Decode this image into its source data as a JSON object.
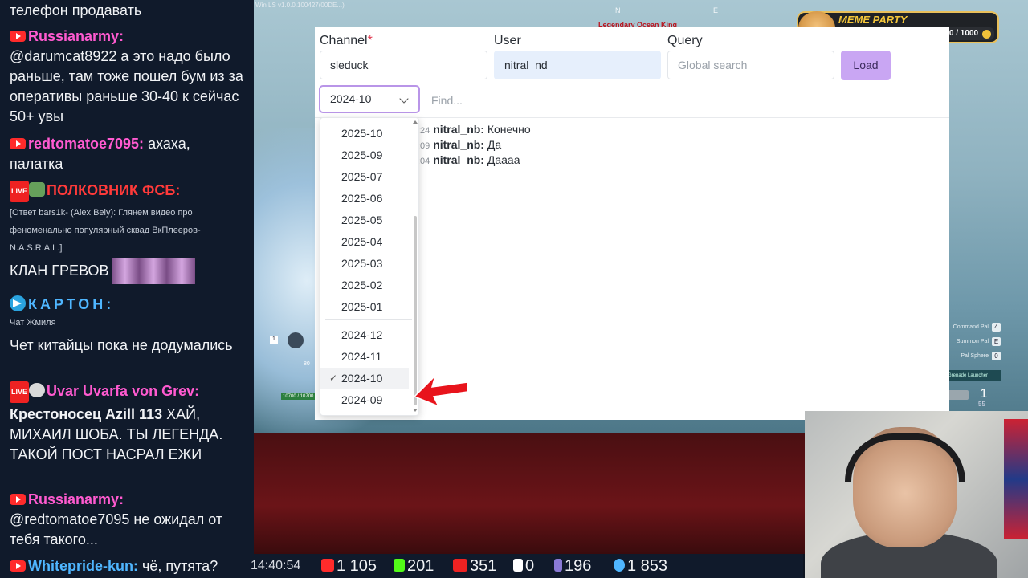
{
  "game": {
    "window_label": "Win LS v1.0.0.100427(00DE...)",
    "compass_n": "N",
    "compass_e": "E",
    "boss_name": "Legendary Ocean King",
    "hud_items": [
      {
        "label": "Command Pal",
        "key": "4"
      },
      {
        "label": "Summon Pal",
        "key": "E"
      },
      {
        "label": "Pal Sphere",
        "key": "0"
      }
    ],
    "launcher": "Grenade Launcher",
    "ammo": "1",
    "ammo_reserve": "55",
    "hp": "10700 / 10700",
    "level": "80"
  },
  "meme_party": {
    "title": "MEME PARTY",
    "count": "200 / 1000"
  },
  "chat": {
    "top_line": "телефон продавать",
    "messages": [
      {
        "author": "Russianarmy:",
        "text": "@darumcat8922 а это надо было раньше, там тоже пошел бум из за оперативы раньше 30-40 к сейчас 50+ увы"
      },
      {
        "author": "redtomatoe7095:",
        "text": "ахаха, палатка"
      },
      {
        "author": "ПОЛКОВНИК ФСБ:",
        "text": "[Ответ bars1k- (Alex Bely): Глянем видео про феноменально популярный сквад ВкПлееров-N.A.S.R.A.L.]"
      },
      {
        "author": "",
        "text": "КЛАН ГРЕВОВ"
      },
      {
        "author": "КАРТОН:",
        "text": "Чат Жмиля"
      },
      {
        "author": "",
        "text": "Чет китайцы пока не додумались"
      },
      {
        "author": "Uvar Uvarfa von Grev:",
        "text_bold": "Крестоносец Azill 113",
        "text": "ХАЙ, МИХАИЛ ШОБА. ТЫ ЛЕГЕНДА. ТАКОЙ ПОСТ НАСРАЛ ЕЖИ"
      },
      {
        "author": "Russianarmy:",
        "text": "@redtomatoe7095 не ожидал от тебя такого..."
      }
    ],
    "bottom_author": "Whitepride-kun:",
    "bottom_text": "чё, путята?"
  },
  "stats": {
    "time": "14:40:54",
    "youtube": "1 105",
    "kick": "201",
    "vk": "351",
    "rutube": "0",
    "hourglass": "196",
    "users": "1 853"
  },
  "app": {
    "channel_label": "Channel",
    "channel_required": "*",
    "channel_value": "sleduck",
    "user_label": "User",
    "user_value": "nitral_nd",
    "query_label": "Query",
    "query_placeholder": "Global search",
    "load_label": "Load",
    "month_selected": "2024-10",
    "find_placeholder": "Find...",
    "logs": [
      {
        "ts": ":24",
        "user": "nitral_nb:",
        "text": "Конечно"
      },
      {
        "ts": ":09",
        "user": "nitral_nb:",
        "text": "Да"
      },
      {
        "ts": ":04",
        "user": "nitral_nb:",
        "text": "Даааа"
      }
    ],
    "month_options": [
      "2025-10",
      "2025-09",
      "2025-07",
      "2025-06",
      "2025-05",
      "2025-04",
      "2025-03",
      "2025-02",
      "2025-01",
      "2024-12",
      "2024-11",
      "2024-10",
      "2024-09"
    ],
    "check_glyph": "✓"
  },
  "colors": {
    "accent": "#c9a6f3",
    "select_border": "#b995e8",
    "arrow": "#e8141c",
    "chat_bg": "#101a2b"
  }
}
